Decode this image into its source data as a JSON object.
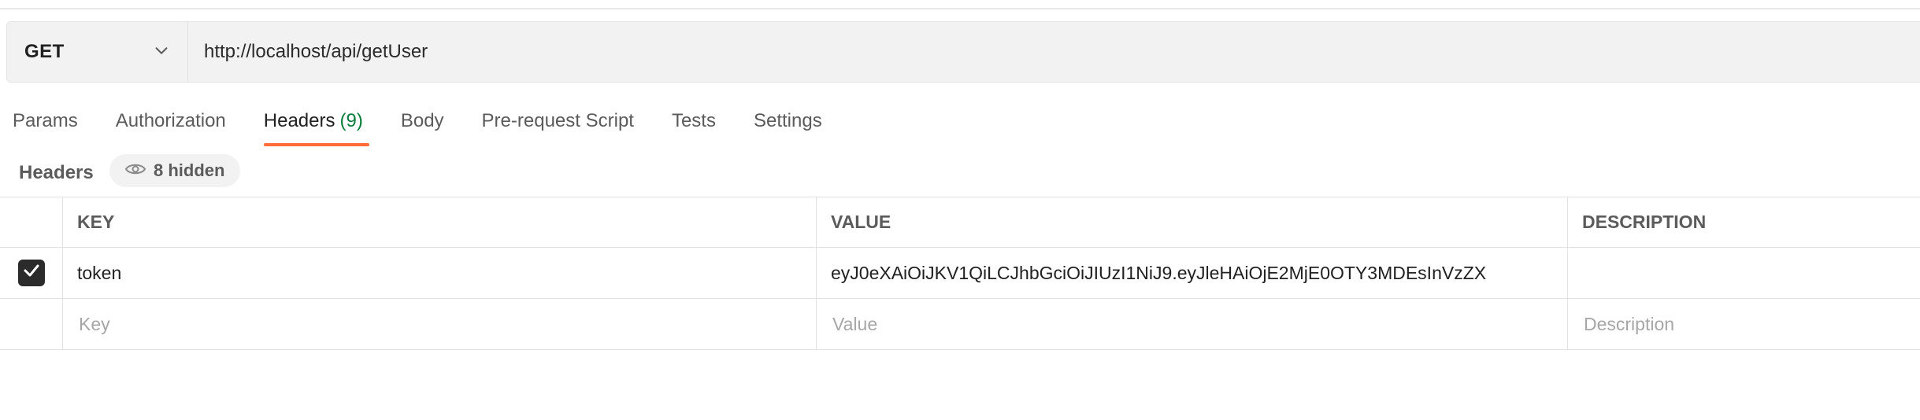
{
  "request": {
    "method": "GET",
    "url": "http://localhost/api/getUser"
  },
  "tabs": [
    {
      "label": "Params"
    },
    {
      "label": "Authorization"
    },
    {
      "label": "Headers",
      "count": "(9)",
      "active": true
    },
    {
      "label": "Body"
    },
    {
      "label": "Pre-request Script"
    },
    {
      "label": "Tests"
    },
    {
      "label": "Settings"
    }
  ],
  "headers_section": {
    "title": "Headers",
    "hidden_label": "8 hidden"
  },
  "table": {
    "columns": [
      "KEY",
      "VALUE",
      "DESCRIPTION"
    ],
    "rows": [
      {
        "checked": true,
        "key": "token",
        "value": "eyJ0eXAiOiJKV1QiLCJhbGciOiJIUzI1NiJ9.eyJleHAiOjE2MjE0OTY3MDEsInVzZX",
        "description": ""
      }
    ],
    "new_row": {
      "key_placeholder": "Key",
      "value_placeholder": "Value",
      "description_placeholder": "Description"
    }
  },
  "colors": {
    "accent": "#ff6c37",
    "count_green": "#0a7d3c"
  },
  "icons": {
    "method_dropdown": "chevron-down-icon",
    "hidden": "eye-icon",
    "checkbox": "check-icon"
  }
}
